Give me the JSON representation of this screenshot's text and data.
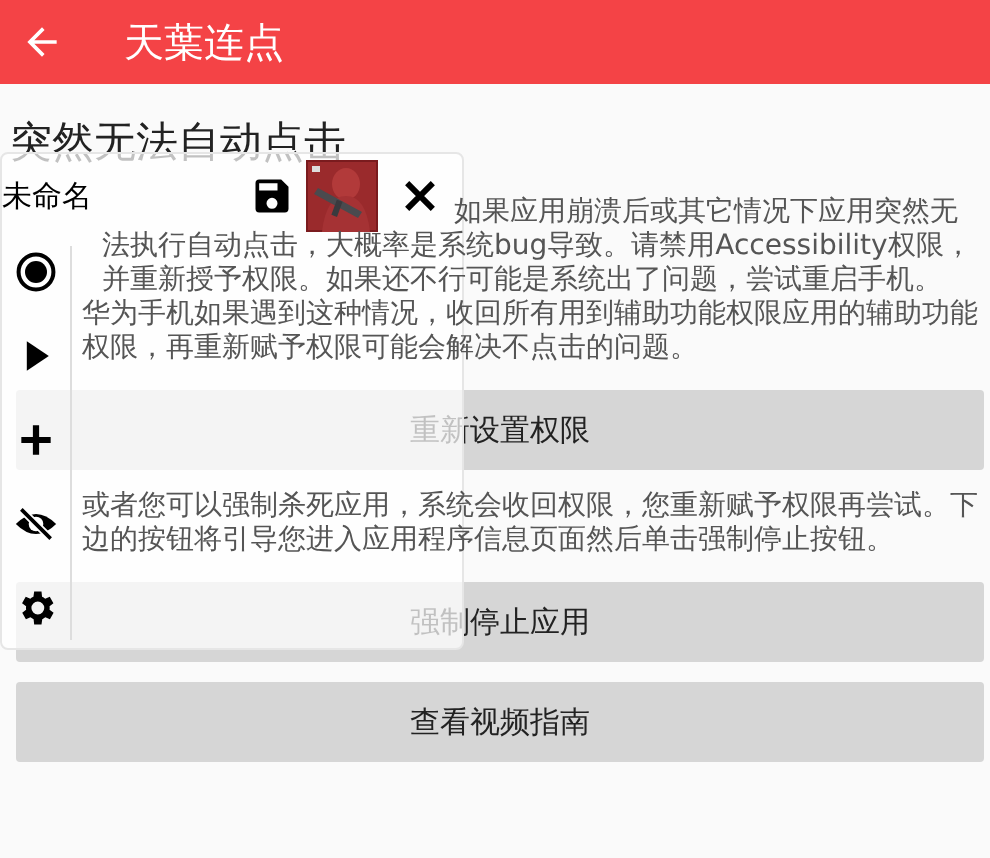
{
  "app_bar": {
    "title": "天葉连点"
  },
  "heading": "突然无法自动点击",
  "content": [
    {
      "kind": "text",
      "text": "如果应用崩溃后或其它情况下应用突然无法执行自动点击，大概率是系统bug导致。请禁用Accessibility权限，并重新授予权限。如果还不行可能是系统出了问题，尝试重启手机。"
    },
    {
      "kind": "text",
      "text": "华为手机如果遇到这种情况，收回所有用到辅助功能权限应用的辅助功能权限，再重新赋予权限可能会解决不点击的问题。"
    },
    {
      "kind": "button",
      "text": "重新设置权限"
    },
    {
      "kind": "text",
      "text": "或者您可以强制杀死应用，系统会收回权限，您重新赋予权限再尝试。下边的按钮将引导您进入应用程序信息页面然后单击强制停止按钮。"
    },
    {
      "kind": "button",
      "text": "强制停止应用"
    },
    {
      "kind": "button",
      "text": "查看视频指南"
    }
  ],
  "overlay": {
    "title": "未命名"
  }
}
